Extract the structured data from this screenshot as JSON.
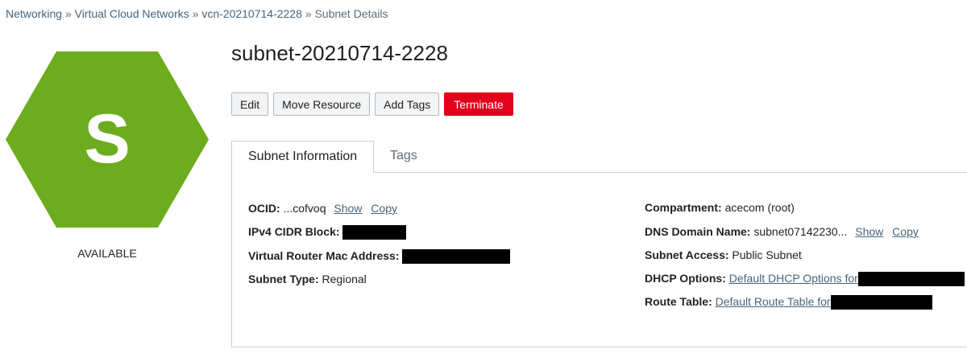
{
  "breadcrumb": {
    "items": [
      "Networking",
      "Virtual Cloud Networks",
      "vcn-20210714-2228",
      "Subnet Details"
    ],
    "separator": "»"
  },
  "resource": {
    "icon_letter": "S",
    "icon_color": "#6cac1e",
    "lifecycle_state": "AVAILABLE",
    "title": "subnet-20210714-2228"
  },
  "actions": {
    "edit": "Edit",
    "move_resource": "Move Resource",
    "add_tags": "Add Tags",
    "terminate": "Terminate"
  },
  "tabs": {
    "subnet_information": "Subnet Information",
    "tags": "Tags"
  },
  "info": {
    "ocid": {
      "label": "OCID:",
      "value": "...cofvoq",
      "show": "Show",
      "copy": "Copy"
    },
    "ipv4_cidr": {
      "label": "IPv4 CIDR Block:"
    },
    "vr_mac": {
      "label": "Virtual Router Mac Address:"
    },
    "subnet_type": {
      "label": "Subnet Type:",
      "value": "Regional"
    },
    "compartment": {
      "label": "Compartment:",
      "value": "acecom (root)"
    },
    "dns_domain": {
      "label": "DNS Domain Name:",
      "value": "subnet07142230...",
      "show": "Show",
      "copy": "Copy"
    },
    "subnet_access": {
      "label": "Subnet Access:",
      "value": "Public Subnet"
    },
    "dhcp_options": {
      "label": "DHCP Options:",
      "link": "Default DHCP Options for"
    },
    "route_table": {
      "label": "Route Table:",
      "link": "Default Route Table for"
    }
  },
  "colors": {
    "link": "#46657c",
    "danger": "#e2001a",
    "available_green": "#6cac1e"
  }
}
